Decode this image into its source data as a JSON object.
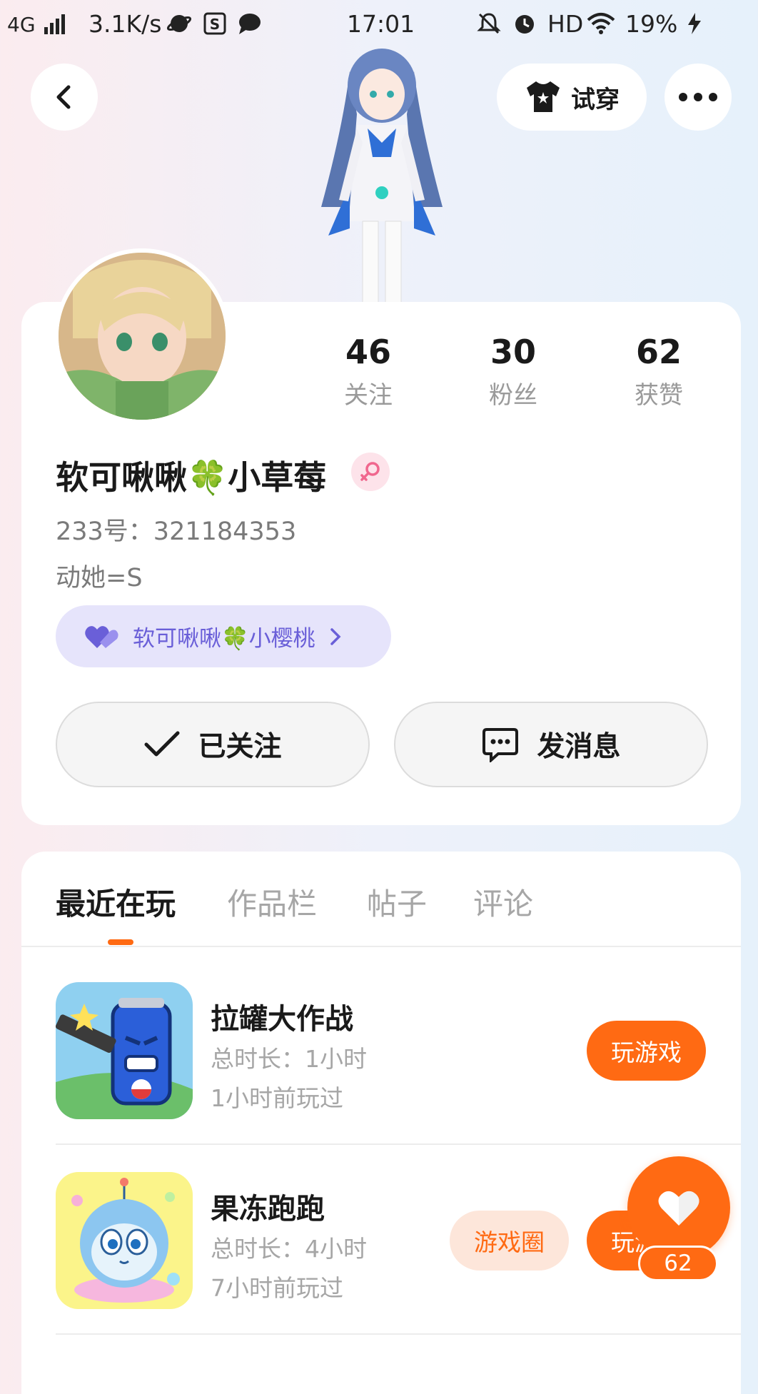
{
  "status_bar": {
    "network": "4G",
    "speed": "3.1K/s",
    "time": "17:01",
    "hd": "HD",
    "battery": "19%"
  },
  "top_bar": {
    "try_on_label": "试穿"
  },
  "profile": {
    "stats": [
      {
        "value": "46",
        "label": "关注"
      },
      {
        "value": "30",
        "label": "粉丝"
      },
      {
        "value": "62",
        "label": "获赞"
      }
    ],
    "name": "软可啾啾🍀小草莓",
    "uid": "233号：321184353",
    "bio": "动她=S",
    "cp_tag": "软可啾啾🍀小樱桃",
    "follow_label": "已关注",
    "message_label": "发消息"
  },
  "tabs": [
    "最近在玩",
    "作品栏",
    "帖子",
    "评论"
  ],
  "games": [
    {
      "title": "拉罐大作战",
      "duration": "总时长：1小时",
      "last_played": "1小时前玩过",
      "play_label": "玩游戏"
    },
    {
      "title": "果冻跑跑",
      "duration": "总时长：4小时",
      "last_played": "7小时前玩过",
      "circle_label": "游戏圈",
      "play_label": "玩游戏"
    }
  ],
  "like_fab": {
    "count": "62"
  },
  "colors": {
    "accent": "#ff6a13",
    "tag_bg": "#e6e4fb",
    "tag_text": "#6a5fd8"
  }
}
